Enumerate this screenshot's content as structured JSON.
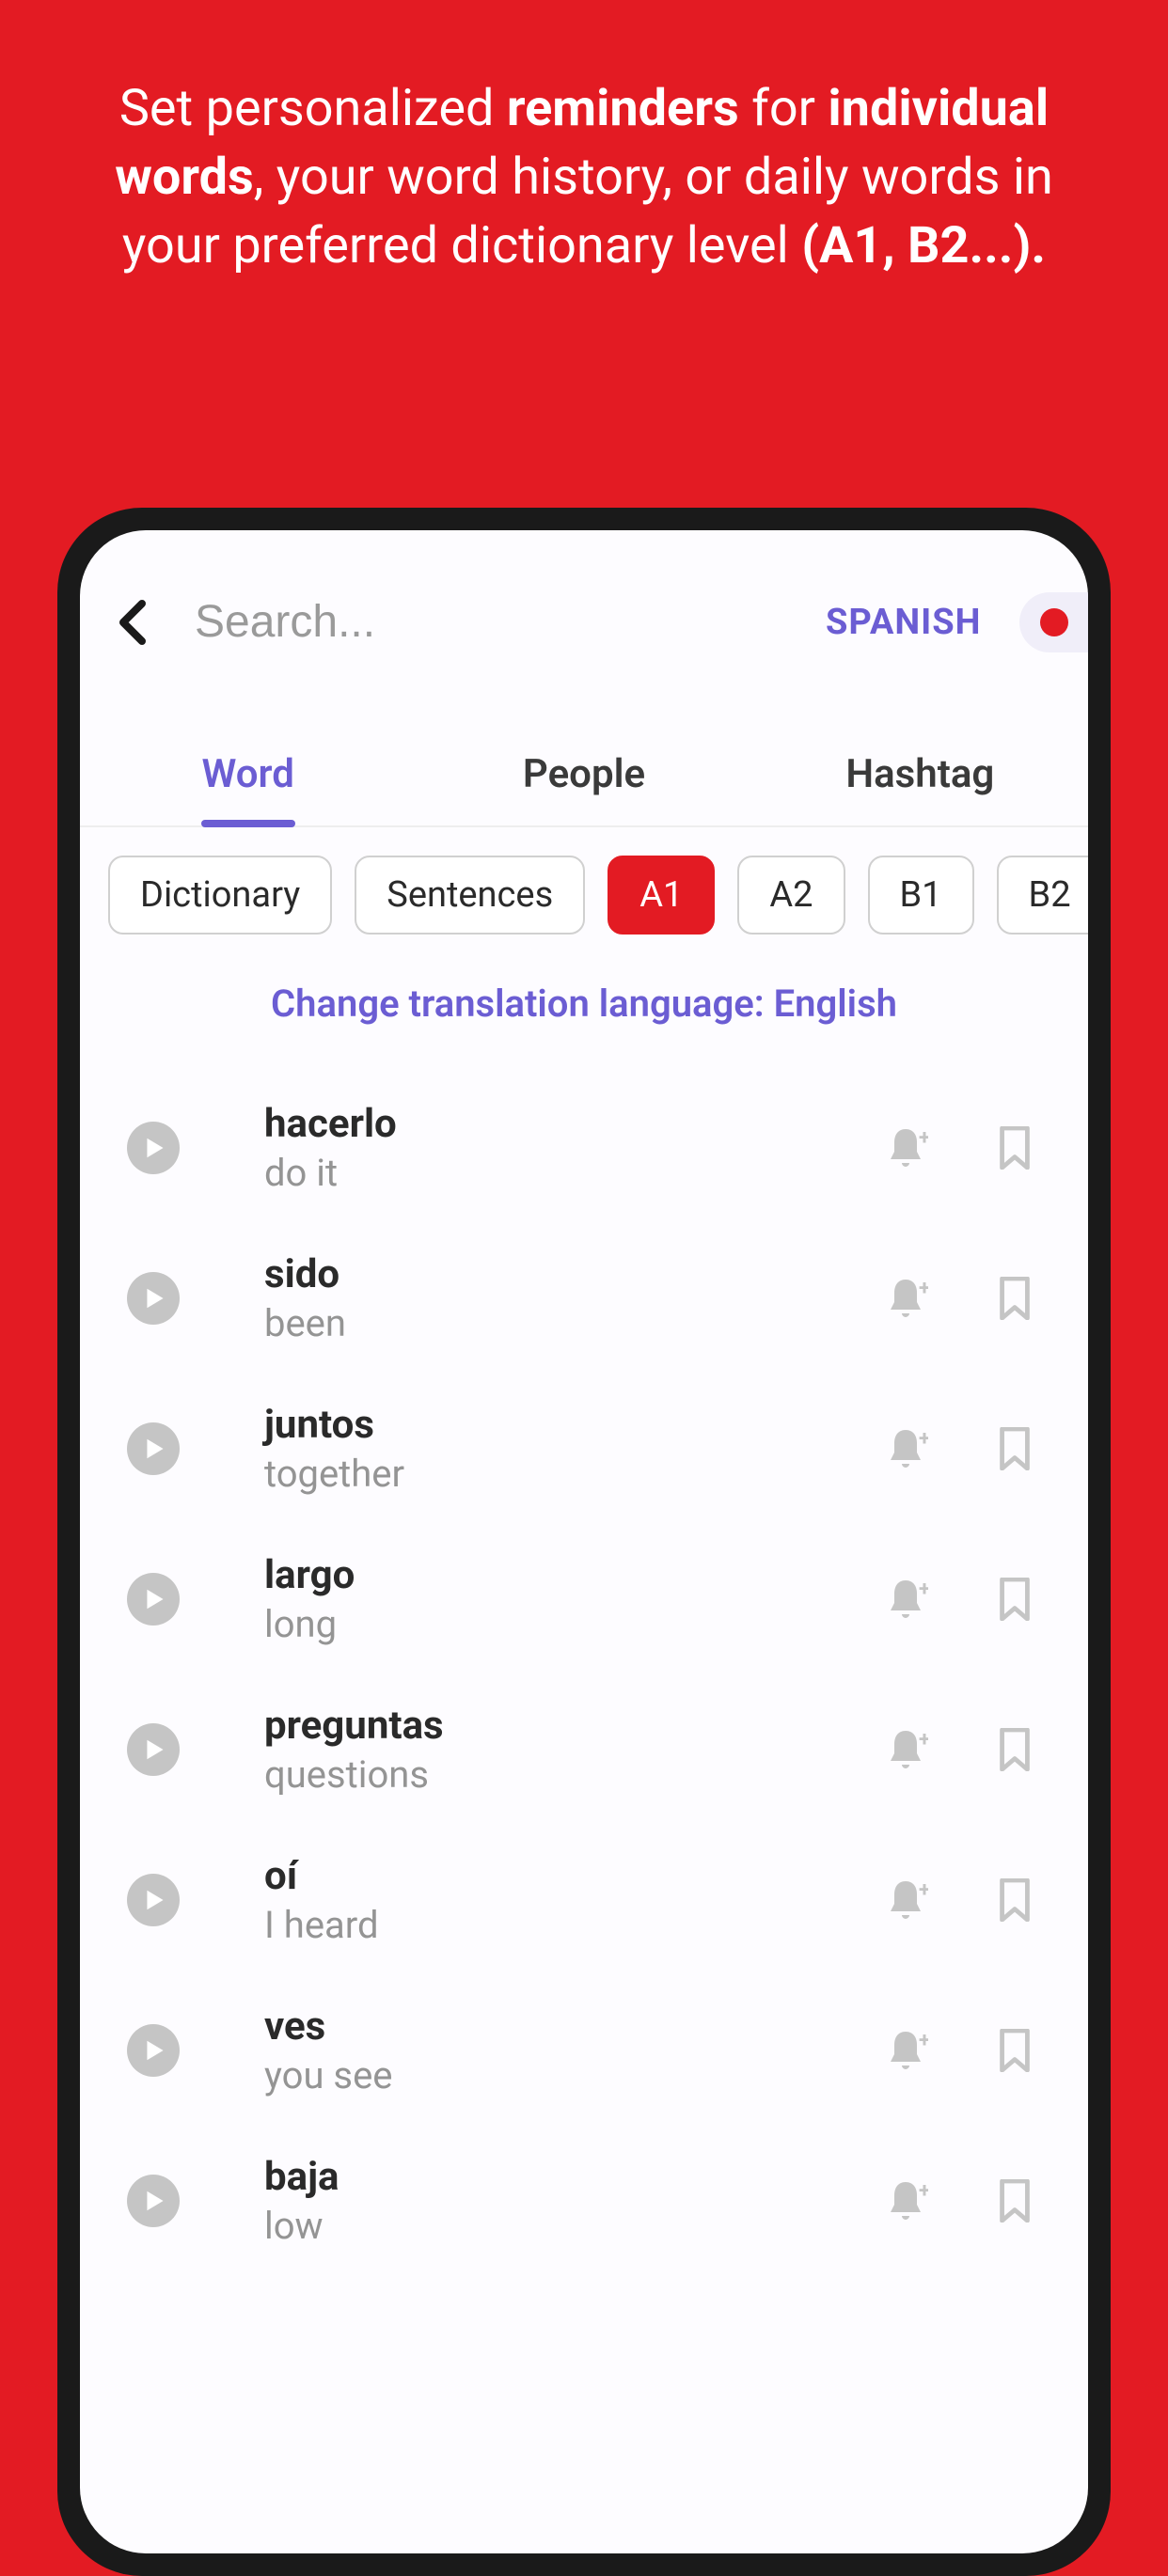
{
  "promo": {
    "parts": [
      {
        "text": "Set personalized ",
        "bold": false
      },
      {
        "text": "reminders",
        "bold": true
      },
      {
        "text": " for ",
        "bold": false
      },
      {
        "text": "individual words",
        "bold": true
      },
      {
        "text": ", your word history, or daily words in your preferred dictionary level ",
        "bold": false
      },
      {
        "text": "(A1, B2...).",
        "bold": true
      }
    ]
  },
  "header": {
    "search_placeholder": "Search...",
    "language_label": "SPANISH"
  },
  "tabs": [
    {
      "label": "Word",
      "active": true
    },
    {
      "label": "People",
      "active": false
    },
    {
      "label": "Hashtag",
      "active": false
    }
  ],
  "filters": [
    {
      "label": "Dictionary",
      "active": false
    },
    {
      "label": "Sentences",
      "active": false
    },
    {
      "label": "A1",
      "active": true
    },
    {
      "label": "A2",
      "active": false
    },
    {
      "label": "B1",
      "active": false
    },
    {
      "label": "B2",
      "active": false
    }
  ],
  "change_language_label": "Change translation language: English",
  "words": [
    {
      "word": "hacerlo",
      "translation": "do it"
    },
    {
      "word": "sido",
      "translation": "been"
    },
    {
      "word": "juntos",
      "translation": "together"
    },
    {
      "word": "largo",
      "translation": "long"
    },
    {
      "word": "preguntas",
      "translation": "questions"
    },
    {
      "word": "oí",
      "translation": "I heard"
    },
    {
      "word": "ves",
      "translation": "you see"
    },
    {
      "word": "baja",
      "translation": "low"
    }
  ],
  "colors": {
    "brand_red": "#e31b23",
    "accent_purple": "#6b5dd3"
  }
}
